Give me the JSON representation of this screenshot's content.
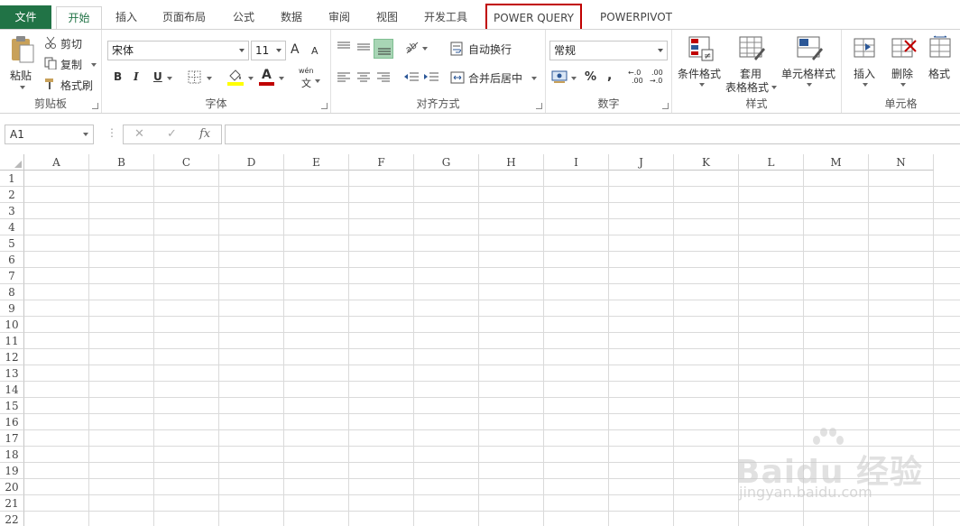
{
  "tabs": {
    "file": "文件",
    "home": "开始",
    "insert": "插入",
    "page_layout": "页面布局",
    "formulas": "公式",
    "data": "数据",
    "review": "审阅",
    "view": "视图",
    "developer": "开发工具",
    "power_query": "POWER QUERY",
    "powerpivot": "POWERPIVOT"
  },
  "clipboard": {
    "paste": "粘贴",
    "cut": "剪切",
    "copy": "复制",
    "format_painter": "格式刷",
    "label": "剪贴板"
  },
  "font": {
    "name": "宋体",
    "size": "11",
    "grow": "A",
    "shrink": "A",
    "bold": "B",
    "italic": "I",
    "underline": "U",
    "font_color_letter": "A",
    "phonetic_top": "wén",
    "phonetic_bottom": "文",
    "label": "字体"
  },
  "alignment": {
    "wrap_text": "自动换行",
    "merge_center": "合并后居中",
    "label": "对齐方式"
  },
  "number": {
    "format": "常规",
    "percent": "%",
    "comma": ",",
    "inc_decimal_top": "←.0",
    "inc_decimal_bottom": ".00",
    "dec_decimal_top": ".00",
    "dec_decimal_bottom": "→.0",
    "label": "数字"
  },
  "styles": {
    "conditional": "条件格式",
    "table_format_1": "套用",
    "table_format_2": "表格格式",
    "cell_styles": "单元格样式",
    "label": "样式"
  },
  "cells_group": {
    "insert": "插入",
    "delete": "删除",
    "format": "格式",
    "label": "单元格"
  },
  "formula_bar": {
    "name_box": "A1",
    "cancel": "✕",
    "enter": "✓",
    "fx": "fx"
  },
  "columns": [
    "A",
    "B",
    "C",
    "D",
    "E",
    "F",
    "G",
    "H",
    "I",
    "J",
    "K",
    "L",
    "M",
    "N"
  ],
  "rows": [
    "1",
    "2",
    "3",
    "4",
    "5",
    "6",
    "7",
    "8",
    "9",
    "10",
    "11",
    "12",
    "13",
    "14",
    "15",
    "16",
    "17",
    "18",
    "19",
    "20",
    "21",
    "22"
  ],
  "watermark": {
    "main": "Baidu 经验",
    "sub": "jingyan.baidu.com"
  },
  "colors": {
    "excel_green": "#217346",
    "highlight_red": "#c00000",
    "fill_yellow": "#ffff00",
    "font_red": "#c00000"
  }
}
